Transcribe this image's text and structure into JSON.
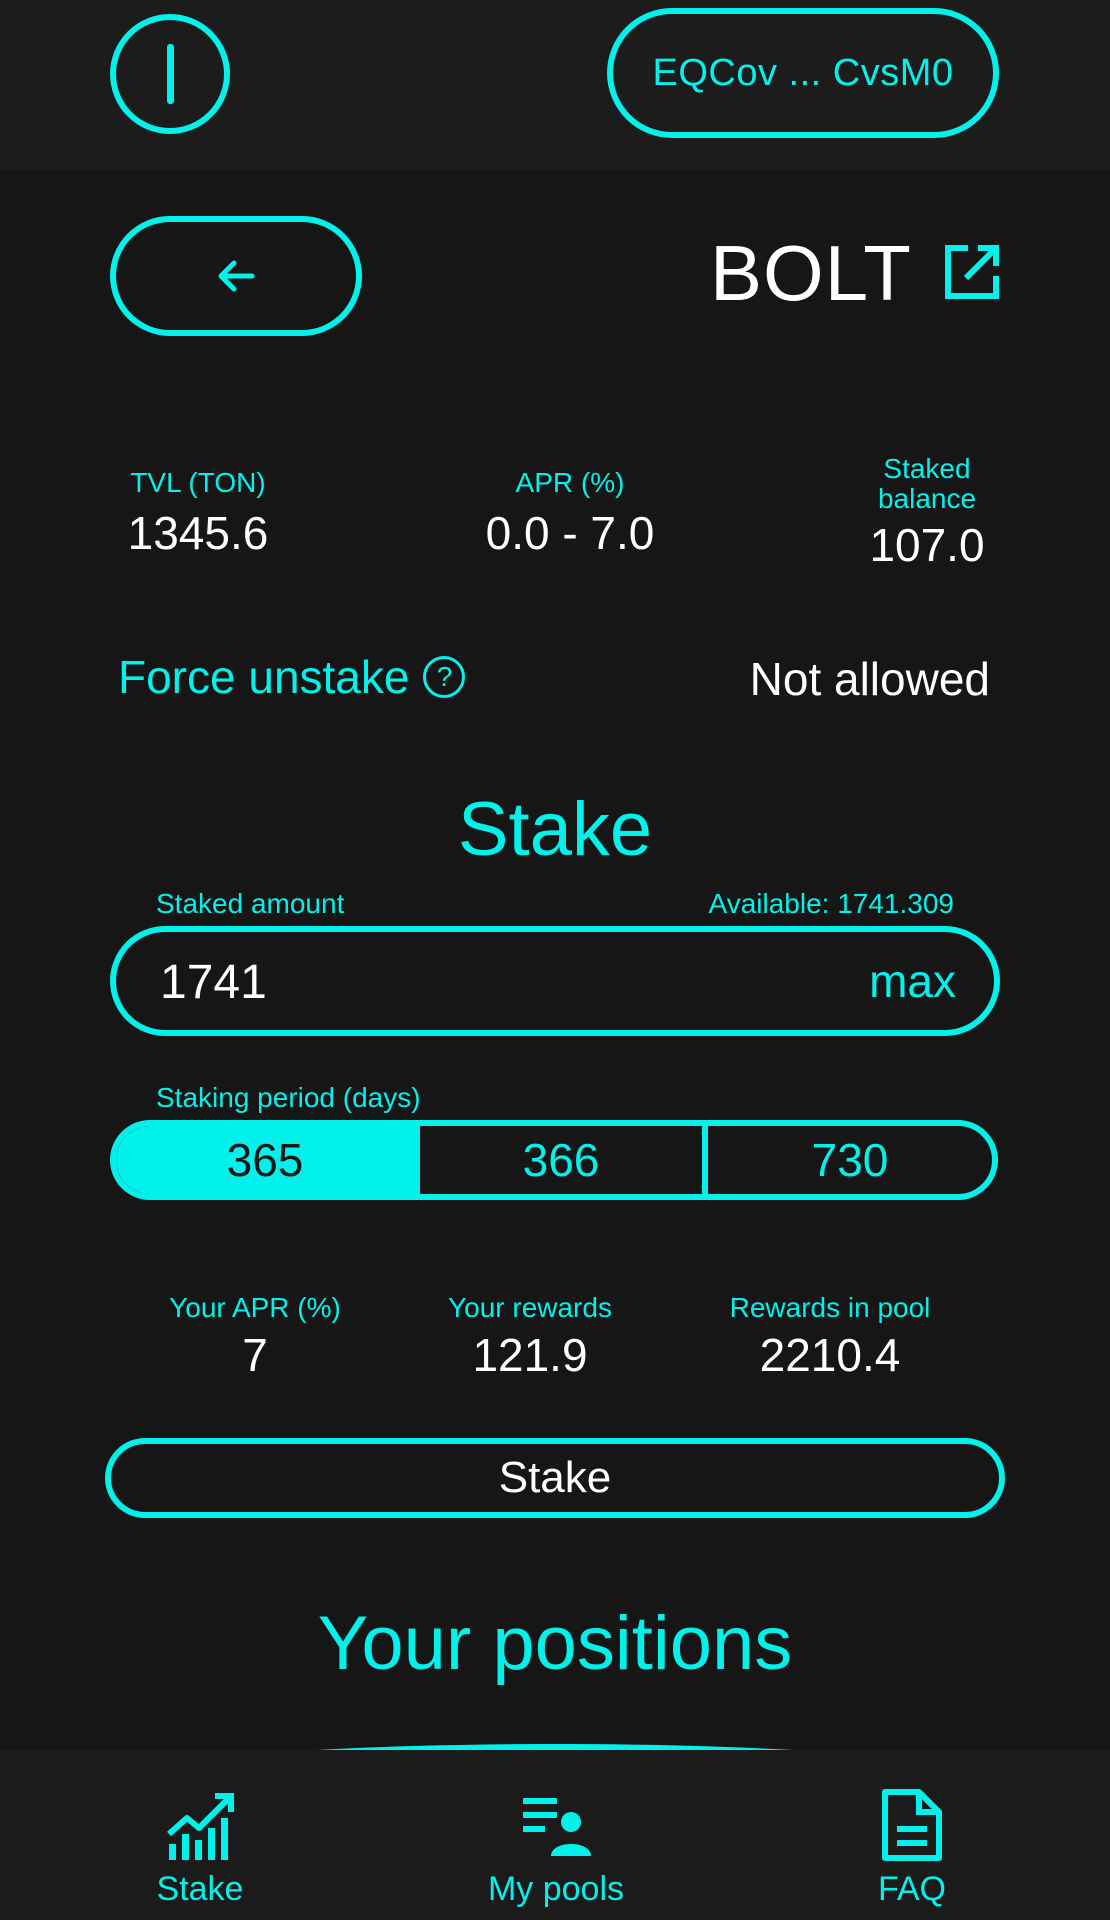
{
  "header": {
    "wallet_address": "EQCov ... CvsM0"
  },
  "pool": {
    "name": "BOLT"
  },
  "stats": {
    "tvl_label": "TVL (TON)",
    "tvl_value": "1345.6",
    "apr_label": "APR (%)",
    "apr_value": "0.0 - 7.0",
    "staked_label_line1": "Staked",
    "staked_label_line2": "balance",
    "staked_value": "107.0"
  },
  "force_unstake": {
    "label": "Force unstake",
    "help": "?",
    "value": "Not allowed"
  },
  "stake_form": {
    "heading": "Stake",
    "amount_label": "Staked amount",
    "available": "Available: 1741.309",
    "amount_value": "1741",
    "max_label": "max",
    "period_label": "Staking period (days)",
    "period_options": [
      "365",
      "366",
      "730"
    ],
    "selected_period": "365",
    "your_apr_label": "Your APR (%)",
    "your_apr_value": "7",
    "your_rewards_label": "Your rewards",
    "your_rewards_value": "121.9",
    "pool_rewards_label": "Rewards in pool",
    "pool_rewards_value": "2210.4",
    "submit_label": "Stake"
  },
  "positions": {
    "heading": "Your positions"
  },
  "nav": {
    "items": [
      {
        "label": "Stake",
        "icon": "chart-icon"
      },
      {
        "label": "My pools",
        "icon": "pool-list-icon"
      },
      {
        "label": "FAQ",
        "icon": "document-icon"
      }
    ]
  },
  "colors": {
    "accent": "#00f2ea",
    "background": "#161616",
    "text": "#ffffff"
  }
}
